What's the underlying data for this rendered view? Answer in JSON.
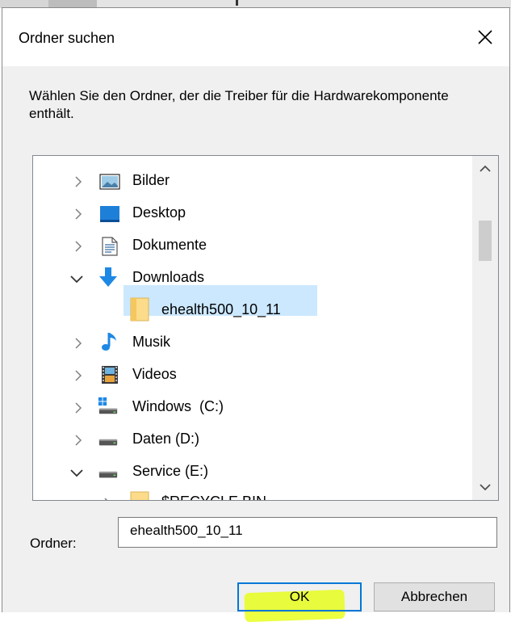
{
  "dialog": {
    "title": "Ordner suchen",
    "instruction": "Wählen Sie den Ordner, der die Treiber für die Hardwarekomponente enthält.",
    "close_icon": "close-icon"
  },
  "tree": {
    "items": [
      {
        "label": "Bilder",
        "icon": "pictures-icon",
        "expanded": false,
        "level": 1
      },
      {
        "label": "Desktop",
        "icon": "desktop-icon",
        "expanded": false,
        "level": 1
      },
      {
        "label": "Dokumente",
        "icon": "documents-icon",
        "expanded": false,
        "level": 1
      },
      {
        "label": "Downloads",
        "icon": "downloads-icon",
        "expanded": true,
        "level": 1
      },
      {
        "label": "ehealth500_10_11",
        "icon": "folder-icon",
        "selected": true,
        "level": 2
      },
      {
        "label": "Musik",
        "icon": "music-icon",
        "expanded": false,
        "level": 1
      },
      {
        "label": "Videos",
        "icon": "videos-icon",
        "expanded": false,
        "level": 1
      },
      {
        "label": "Windows  (C:)",
        "icon": "windows-drive-icon",
        "expanded": false,
        "level": 1
      },
      {
        "label": "Daten (D:)",
        "icon": "drive-icon",
        "expanded": false,
        "level": 1
      },
      {
        "label": "Service (E:)",
        "icon": "drive-icon",
        "expanded": true,
        "level": 1
      },
      {
        "label": "$RECYCLE.BIN",
        "icon": "folder-icon",
        "expanded": false,
        "level": 2
      }
    ]
  },
  "folder_field": {
    "label": "Ordner:",
    "value": "ehealth500_10_11"
  },
  "buttons": {
    "ok": "OK",
    "cancel": "Abbrechen"
  },
  "colors": {
    "selection": "#cce8ff",
    "accent": "#0078d7",
    "highlight": "#e6ff00"
  }
}
